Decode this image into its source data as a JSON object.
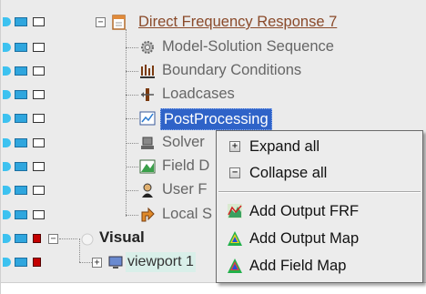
{
  "tree": {
    "root": {
      "label": "Direct Frequency Response 7",
      "expander": "−"
    },
    "children": [
      {
        "label": "Model-Solution Sequence",
        "icon": "gear-icon"
      },
      {
        "label": "Boundary Conditions",
        "icon": "boundary-icon"
      },
      {
        "label": "Loadcases",
        "icon": "loadcase-icon"
      },
      {
        "label": "PostProcessing",
        "icon": "chart-icon"
      },
      {
        "label": "Solver",
        "icon": "solver-icon"
      },
      {
        "label": "Field D",
        "icon": "field-icon"
      },
      {
        "label": "User F",
        "icon": "user-icon"
      },
      {
        "label": "Local S",
        "icon": "local-icon"
      }
    ],
    "visual": {
      "label": "Visual",
      "expander": "−"
    },
    "viewport": {
      "label": "viewport 1",
      "expander": "+"
    }
  },
  "context_menu": {
    "items": [
      {
        "label": "Expand all",
        "icon": "expand-icon",
        "symbol": "+"
      },
      {
        "label": "Collapse all",
        "icon": "collapse-icon",
        "symbol": "−"
      },
      {
        "label": "Add Output FRF",
        "icon": "output-frf-icon"
      },
      {
        "label": "Add Output Map",
        "icon": "output-map-icon"
      },
      {
        "label": "Add Field Map",
        "icon": "field-map-icon"
      }
    ]
  },
  "colors": {
    "selected_bg": "#2f63c8",
    "indicator_blue": "#2fa6de",
    "indicator_red": "#c40000",
    "root_label": "#8a4a2a"
  }
}
